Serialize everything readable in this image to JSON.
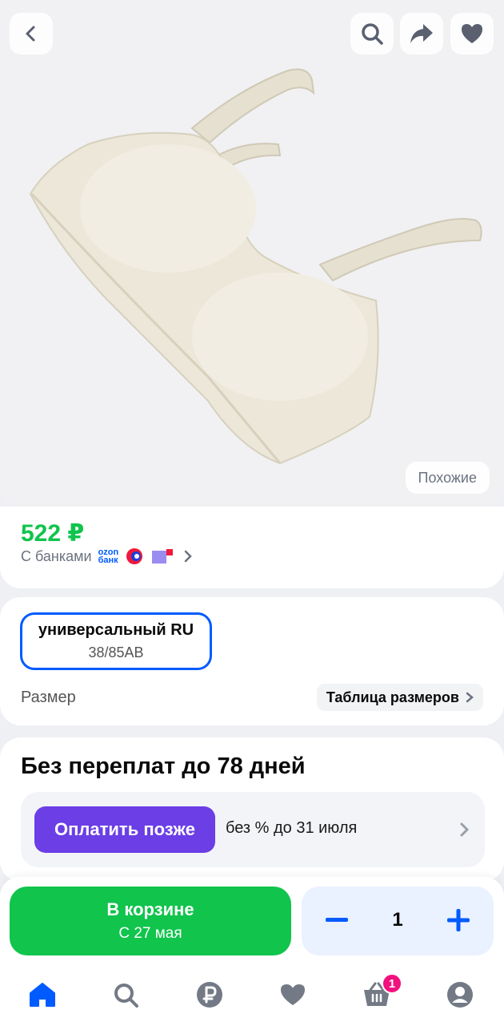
{
  "header": {
    "back_icon": "chevron-left-icon",
    "search_icon": "search-icon",
    "share_icon": "share-arrow-icon",
    "favorite_icon": "heart-icon"
  },
  "hero": {
    "similar_label": "Похожие"
  },
  "price": {
    "value": "522 ₽",
    "banks_label": "С банками",
    "ozon_bank_top": "ozon",
    "ozon_bank_bottom": "банк"
  },
  "size": {
    "selected_name": "универсальный RU",
    "selected_value": "38/85AB",
    "label": "Размер",
    "table_link": "Таблица размеров"
  },
  "payment": {
    "title": "Без переплат до 78 дней",
    "button_label": "Оплатить позже",
    "note": "без % до 31 июля"
  },
  "cart": {
    "button_title": "В корзине",
    "button_subtitle": "С 27 мая",
    "quantity": "1"
  },
  "nav": {
    "cart_badge": "1",
    "items": [
      "home-icon",
      "search-icon",
      "ruble-icon",
      "heart-icon",
      "basket-icon",
      "profile-icon"
    ]
  },
  "colors": {
    "green": "#10c44c",
    "blue": "#005bff",
    "purple": "#6b3ee6",
    "badge_pink": "#f1117e"
  }
}
